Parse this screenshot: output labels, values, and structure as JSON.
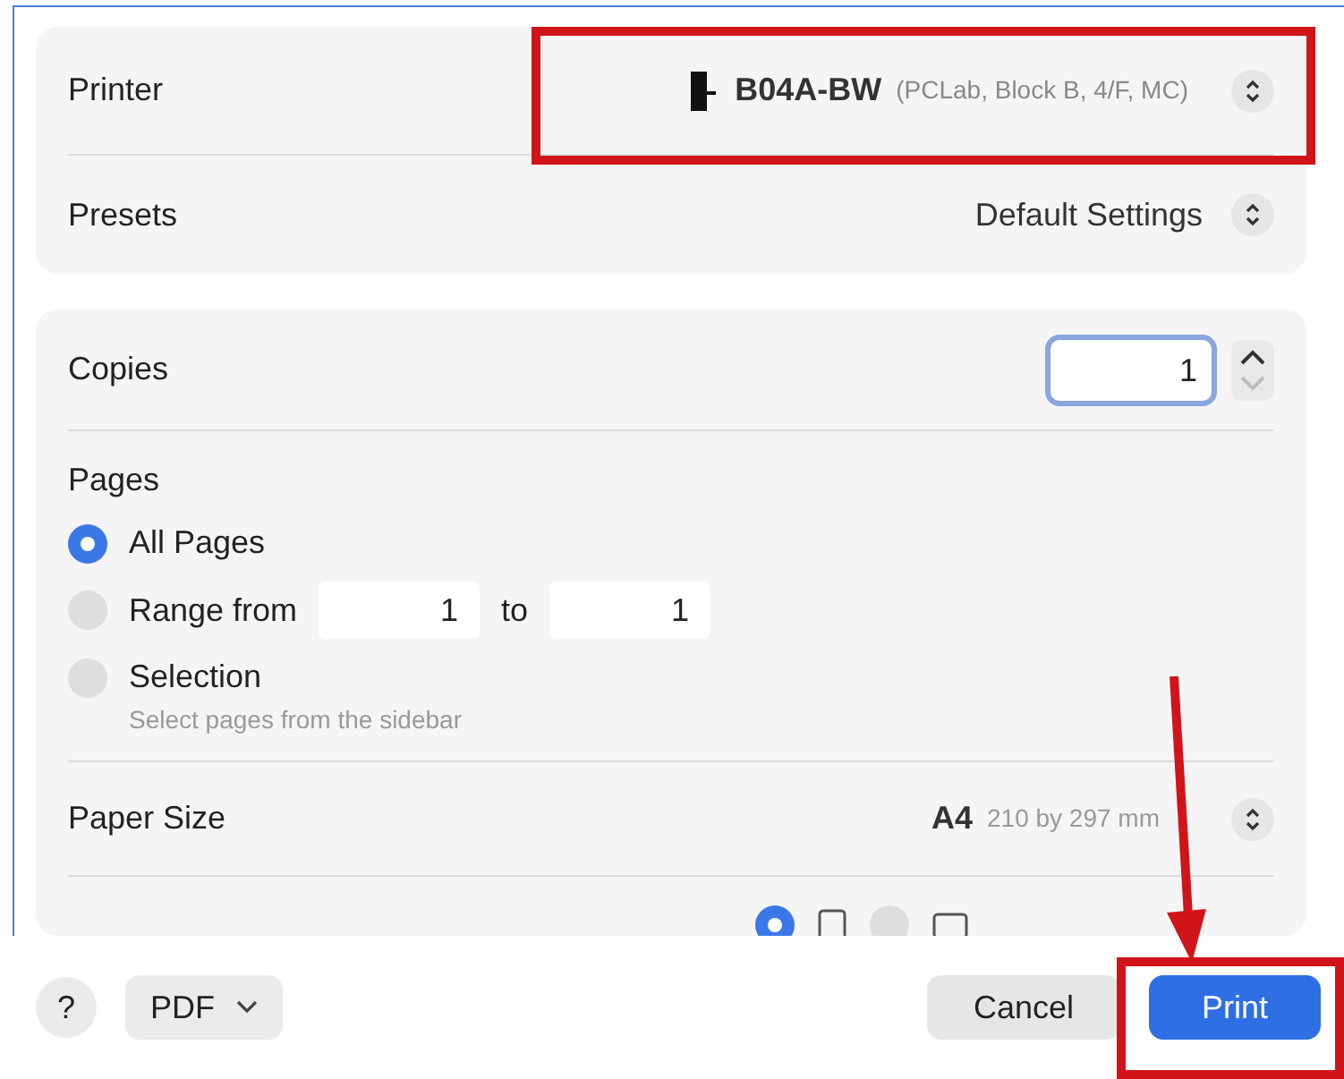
{
  "printer": {
    "label": "Printer",
    "name": "B04A-BW",
    "location": "(PCLab, Block B, 4/F, MC)"
  },
  "presets": {
    "label": "Presets",
    "value": "Default Settings"
  },
  "copies": {
    "label": "Copies",
    "value": "1"
  },
  "pages": {
    "label": "Pages",
    "options": [
      {
        "kind": "all",
        "label": "All Pages",
        "selected": true
      },
      {
        "kind": "range",
        "label": "Range from",
        "from": "1",
        "to_label": "to",
        "to": "1",
        "selected": false
      },
      {
        "kind": "selection",
        "label": "Selection",
        "hint": "Select pages from the sidebar",
        "selected": false
      }
    ]
  },
  "paper_size": {
    "label": "Paper Size",
    "value": "A4",
    "detail": "210 by 297 mm"
  },
  "orientation": {
    "options": [
      {
        "kind": "portrait",
        "selected": true
      },
      {
        "kind": "landscape",
        "selected": false
      }
    ]
  },
  "footer": {
    "help": "?",
    "pdf": "PDF",
    "cancel": "Cancel",
    "print": "Print"
  }
}
